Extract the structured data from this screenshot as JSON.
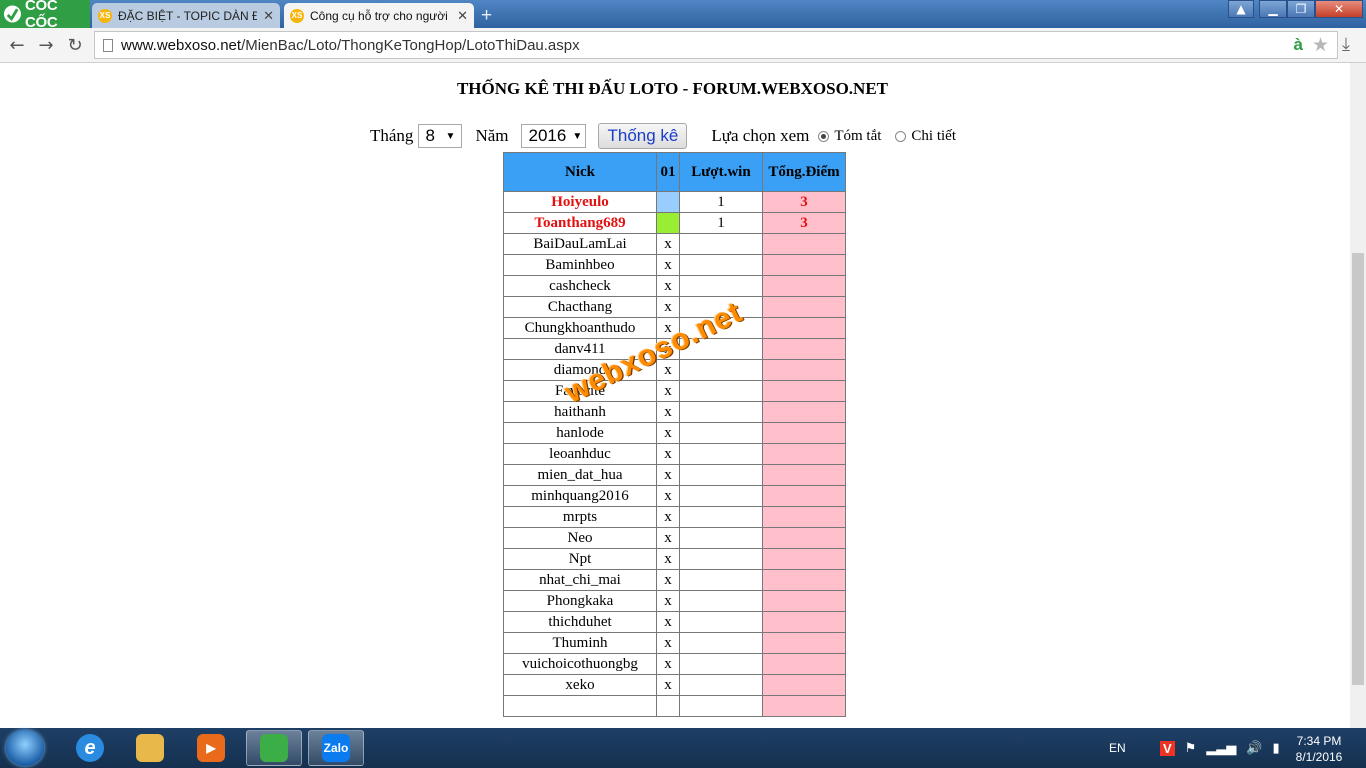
{
  "browser": {
    "brand": "CỐC CỐC",
    "tabs": [
      {
        "label": "ĐẶC BIỆT - TOPIC DÀN Đ",
        "favicon": "XS",
        "active": false
      },
      {
        "label": "Công cụ hỗ trợ cho người",
        "favicon": "XS",
        "active": true
      }
    ],
    "url_host": "www.webxoso.net",
    "url_path": "/MienBac/Loto/ThongKeTongHop/LotoThiDau.aspx",
    "addon_letter": "à"
  },
  "page": {
    "title": "THỐNG KÊ THI ĐẤU LOTO - FORUM.WEBXOSO.NET",
    "month_label": "Tháng",
    "month_value": "8",
    "year_label": "Năm",
    "year_value": "2016",
    "stats_button": "Thống kê",
    "view_label": "Lựa chọn xem",
    "view_options": [
      {
        "label": "Tóm tắt",
        "selected": true
      },
      {
        "label": "Chi tiết",
        "selected": false
      }
    ],
    "watermark": "webxoso.net"
  },
  "table": {
    "headers": [
      "Nick",
      "01",
      "Lượt.win",
      "Tổng.Điểm"
    ],
    "rows": [
      {
        "nick": "Hoiyeulo",
        "d01": "",
        "d01_color": "#99ccff",
        "win": "1",
        "points": "3",
        "highlight": true
      },
      {
        "nick": "Toanthang689",
        "d01": "",
        "d01_color": "#99ee33",
        "win": "1",
        "points": "3",
        "highlight": true
      },
      {
        "nick": "BaiDauLamLai",
        "d01": "x",
        "win": "",
        "points": ""
      },
      {
        "nick": "Baminhbeo",
        "d01": "x",
        "win": "",
        "points": ""
      },
      {
        "nick": "cashcheck",
        "d01": "x",
        "win": "",
        "points": ""
      },
      {
        "nick": "Chacthang",
        "d01": "x",
        "win": "",
        "points": ""
      },
      {
        "nick": "Chungkhoanthudo",
        "d01": "x",
        "win": "",
        "points": ""
      },
      {
        "nick": "danv411",
        "d01": "x",
        "win": "",
        "points": ""
      },
      {
        "nick": "diamond",
        "d01": "x",
        "win": "",
        "points": ""
      },
      {
        "nick": "Favorite",
        "d01": "x",
        "win": "",
        "points": ""
      },
      {
        "nick": "haithanh",
        "d01": "x",
        "win": "",
        "points": ""
      },
      {
        "nick": "hanlode",
        "d01": "x",
        "win": "",
        "points": ""
      },
      {
        "nick": "leoanhduc",
        "d01": "x",
        "win": "",
        "points": ""
      },
      {
        "nick": "mien_dat_hua",
        "d01": "x",
        "win": "",
        "points": ""
      },
      {
        "nick": "minhquang2016",
        "d01": "x",
        "win": "",
        "points": ""
      },
      {
        "nick": "mrpts",
        "d01": "x",
        "win": "",
        "points": ""
      },
      {
        "nick": "Neo",
        "d01": "x",
        "win": "",
        "points": ""
      },
      {
        "nick": "Npt",
        "d01": "x",
        "win": "",
        "points": ""
      },
      {
        "nick": "nhat_chi_mai",
        "d01": "x",
        "win": "",
        "points": ""
      },
      {
        "nick": "Phongkaka",
        "d01": "x",
        "win": "",
        "points": ""
      },
      {
        "nick": "thichduhet",
        "d01": "x",
        "win": "",
        "points": ""
      },
      {
        "nick": "Thuminh",
        "d01": "x",
        "win": "",
        "points": ""
      },
      {
        "nick": "vuichoicothuongbg",
        "d01": "x",
        "win": "",
        "points": ""
      },
      {
        "nick": "xeko",
        "d01": "x",
        "win": "",
        "points": ""
      },
      {
        "nick": "",
        "d01": "",
        "win": "",
        "points": ""
      }
    ]
  },
  "taskbar": {
    "apps": [
      {
        "name": "internet-explorer",
        "label": "e",
        "color": "#2b8be0"
      },
      {
        "name": "file-explorer",
        "label": "",
        "color": "#e8b84a"
      },
      {
        "name": "media-player",
        "label": "▶",
        "color": "#e86a1a"
      },
      {
        "name": "coccoc-browser",
        "label": "",
        "color": "#3cae48"
      },
      {
        "name": "zalo",
        "label": "Zalo",
        "color": "#0a7cf0"
      }
    ],
    "language": "EN",
    "time": "7:34 PM",
    "date": "8/1/2016"
  }
}
